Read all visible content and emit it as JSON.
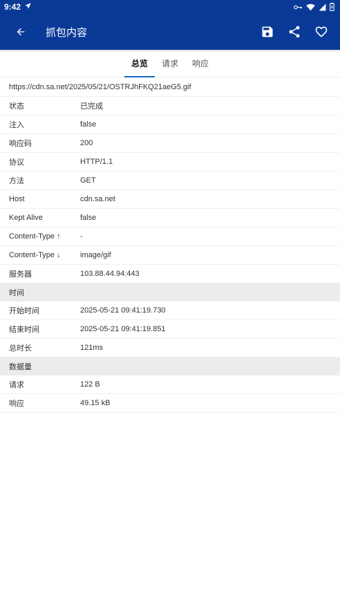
{
  "status_bar": {
    "time": "9:42"
  },
  "app_bar": {
    "title": "抓包内容"
  },
  "tabs": [
    {
      "label": "总览",
      "active": true
    },
    {
      "label": "请求",
      "active": false
    },
    {
      "label": "响应",
      "active": false
    }
  ],
  "url": "https://cdn.sa.net/2025/05/21/OSTRJhFKQ21aeG5.gif",
  "overview": [
    {
      "label": "状态",
      "value": "已完成"
    },
    {
      "label": "注入",
      "value": "false"
    },
    {
      "label": "响应码",
      "value": "200"
    },
    {
      "label": "协议",
      "value": "HTTP/1.1"
    },
    {
      "label": "方法",
      "value": "GET"
    },
    {
      "label": "Host",
      "value": "cdn.sa.net"
    },
    {
      "label": "Kept Alive",
      "value": "false"
    },
    {
      "label": "Content-Type ↑",
      "value": "-"
    },
    {
      "label": "Content-Type ↓",
      "value": "image/gif"
    },
    {
      "label": "服务器",
      "value": "103.88.44.94:443"
    }
  ],
  "timing_section": {
    "title": "时间",
    "rows": [
      {
        "label": "开始时间",
        "value": "2025-05-21 09:41:19.730"
      },
      {
        "label": "结束时间",
        "value": "2025-05-21 09:41:19.851"
      },
      {
        "label": "总时长",
        "value": "121ms"
      }
    ]
  },
  "size_section": {
    "title": "数据量",
    "rows": [
      {
        "label": "请求",
        "value": "122 B"
      },
      {
        "label": "响应",
        "value": "49.15 kB"
      }
    ]
  },
  "colors": {
    "app_bar": "#0a3a98",
    "tab_indicator": "#1565c0",
    "section_bg": "#ececec"
  },
  "icons": {
    "back": "arrow-left-icon",
    "save": "save-icon",
    "share": "share-icon",
    "favorite": "heart-outline-icon"
  }
}
